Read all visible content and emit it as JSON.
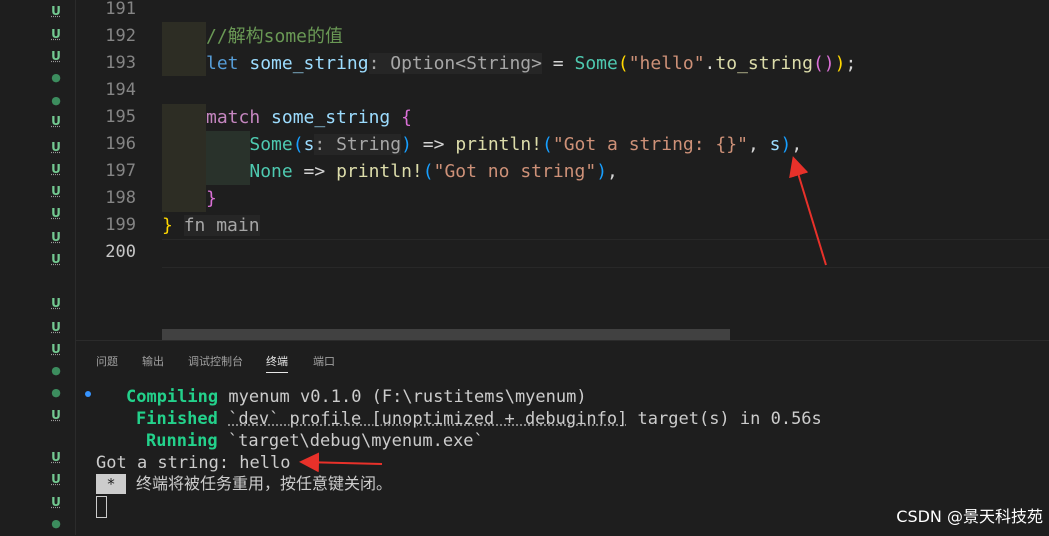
{
  "gutter": {
    "git_marks": [
      {
        "kind": "u",
        "label": "U"
      },
      {
        "kind": "u",
        "label": "U"
      },
      {
        "kind": "u",
        "label": "U"
      },
      {
        "kind": "dot",
        "label": "●"
      },
      {
        "kind": "dot",
        "label": "●"
      },
      {
        "kind": "u",
        "label": "U"
      },
      {
        "kind": "u",
        "label": "U"
      },
      {
        "kind": "u",
        "label": "U"
      },
      {
        "kind": "u",
        "label": "U"
      },
      {
        "kind": "u",
        "label": "U"
      },
      {
        "kind": "u",
        "label": "U"
      },
      {
        "kind": "u",
        "label": "U"
      },
      {
        "kind": "u",
        "label": "U"
      },
      {
        "kind": "u",
        "label": "U"
      },
      {
        "kind": "u",
        "label": "U"
      },
      {
        "kind": "dot",
        "label": "●"
      },
      {
        "kind": "dot",
        "label": "●"
      },
      {
        "kind": "u",
        "label": "U"
      },
      {
        "kind": "u",
        "label": "U"
      },
      {
        "kind": "u",
        "label": "U"
      },
      {
        "kind": "u",
        "label": "U"
      },
      {
        "kind": "dot",
        "label": "●"
      }
    ]
  },
  "editor": {
    "line_numbers": [
      "191",
      "192",
      "193",
      "194",
      "195",
      "196",
      "197",
      "198",
      "199",
      "200"
    ],
    "active_line": "200",
    "code": {
      "comment": "//解构some的值",
      "let_kw": "let",
      "var_name": "some_string",
      "type_hint": ": Option<String>",
      "eq": " = ",
      "some_ctor": "Some",
      "hello_str": "\"hello\"",
      "to_string": "to_string",
      "match_kw": "match",
      "match_target": "some_string",
      "open_brace": "{",
      "arm1_ctor": "Some",
      "arm1_bind": "s",
      "arm1_hint": ": String",
      "arrow": " => ",
      "println": "println!",
      "fmt1": "\"Got a string: {}\"",
      "arg_s": "s",
      "arm2_ctor": "None",
      "fmt2": "\"Got no string\"",
      "close_brace": "}",
      "fn_close_brace": "}",
      "fn_hint": "fn main"
    }
  },
  "panel": {
    "tabs": [
      "问题",
      "输出",
      "调试控制台",
      "终端",
      "端口"
    ],
    "active_tab": "终端",
    "terminal": {
      "compiling_label": "Compiling",
      "compiling_text": "myenum v0.1.0 (F:\\rustitems\\myenum)",
      "finished_label": "Finished",
      "finished_pre": "`dev` profile [unoptimized + debuginfo]",
      "finished_post": " target(s) in 0.56s",
      "running_label": "Running",
      "running_text": "`target\\debug\\myenum.exe`",
      "output_line": "Got a string: hello",
      "star": "*",
      "reuse_msg": "终端将被任务重用，按任意键关闭。"
    }
  },
  "watermark": "CSDN @景天科技苑",
  "colors": {
    "annotation_arrow": "#e8312a",
    "editor_bg": "#1e1e1e"
  }
}
